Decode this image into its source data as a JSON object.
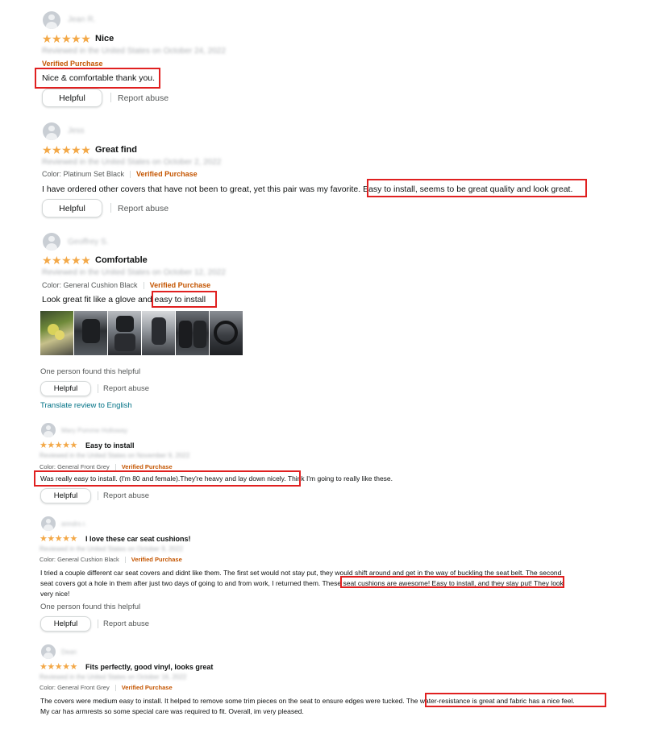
{
  "helpful_label": "Helpful",
  "report_label": "Report abuse",
  "stars": "★★★★★",
  "colors": {
    "star": "#f3a847",
    "verified": "#c45500",
    "highlight": "#e02020",
    "link": "#007185"
  },
  "reviews": [
    {
      "reviewer": "Jean R.",
      "title": "Nice",
      "date": "Reviewed in the United States on October 24, 2022",
      "verified": "Verified Purchase",
      "text": "Nice & comfortable thank you."
    },
    {
      "reviewer": "Jess",
      "title": "Great find",
      "date": "Reviewed in the United States on October 2, 2022",
      "color": "Color: Platinum Set Black",
      "verified": "Verified Purchase",
      "text_before": "I have ordered other covers that have not been to great, yet this pair was my favorite.",
      "text_highlight": "Easy to install, seems to be great quality and look great."
    },
    {
      "reviewer": "Geoffrey S.",
      "title": "Comfortable",
      "date": "Reviewed in the United States on October 12, 2022",
      "color": "Color: General Cushion Black",
      "verified": "Verified Purchase",
      "text_before": "Look great fit like a glove and",
      "text_highlight": "easy to install",
      "found": "One person found this helpful",
      "translate": "Translate review to English",
      "photos": [
        "review-photo-1",
        "review-photo-2",
        "review-photo-3",
        "review-photo-4",
        "review-photo-5",
        "review-photo-6"
      ]
    },
    {
      "reviewer": "Mary Pomme Holloway",
      "title": "Easy to install",
      "date": "Reviewed in the United States on November 9, 2022",
      "color": "Color: General Front Grey",
      "verified": "Verified Purchase",
      "text_highlight": "Was really easy to install. (I'm 80 and female).They're heavy and lay down nicely.",
      "text_after": "Think I'm going to really like these."
    },
    {
      "reviewer": "anndrs r.",
      "title": "I love these car seat cushions!",
      "date": "Reviewed in the United States on October 9, 2022",
      "color": "Color: General Cushion Black",
      "verified": "Verified Purchase",
      "line1": "I tried a couple different car seat covers and didnt like them. The first set would not stay put, they would shift around and get in the way of buckling the seat belt. The second",
      "line2_before": "seat covers got a hole in them after just two days of going to and from work, I returned them.",
      "text_highlight": "These seat cushions are awesome! Easy to install, and they stay put!",
      "line2_after": "They look",
      "line3": "very nice!",
      "found": "One person found this helpful"
    },
    {
      "reviewer": "Dean",
      "title": "Fits perfectly, good vinyl, looks great",
      "date": "Reviewed in the United States on October 16, 2022",
      "color": "Color: General Front Grey",
      "verified": "Verified Purchase",
      "line1_before": "The covers were medium easy to install. It helped to remove some trim pieces on the seat to ensure edges were tucked.",
      "text_highlight": "The water-resistance is great and fabric has a nice feel.",
      "line2": "My car has armrests so some special care was required to fit. Overall, im very pleased."
    }
  ]
}
